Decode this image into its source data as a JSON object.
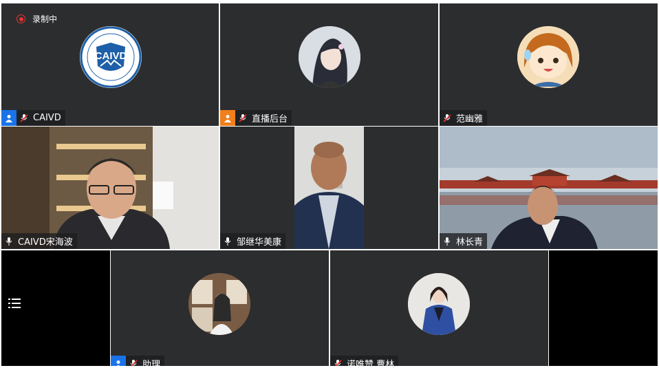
{
  "recording": {
    "label": "录制中"
  },
  "participants": [
    {
      "name": "CAIVD",
      "role": "host",
      "mic": "muted",
      "avatar": "caivd-logo",
      "logo_text": "CAIVD"
    },
    {
      "name": "直播后台",
      "role": "cohost",
      "mic": "muted",
      "avatar": "anime-girl-icon"
    },
    {
      "name": "范幽雅",
      "role": "",
      "mic": "muted",
      "avatar": "cartoon-girl-icon"
    },
    {
      "name": "CAIVD宋海波",
      "role": "",
      "mic": "on",
      "video": "man-in-office"
    },
    {
      "name": "邹继华美康",
      "role": "",
      "mic": "on",
      "video": "man-in-blue-jacket"
    },
    {
      "name": "林长青",
      "role": "",
      "mic": "on",
      "video": "man-with-forbidden-city-background"
    },
    {
      "name": "助理",
      "role": "host",
      "mic": "muted",
      "avatar": "woman-photo-icon"
    },
    {
      "name": "诺唯赞 曹林",
      "role": "",
      "mic": "muted",
      "avatar": "woman-in-blue-suit-icon"
    }
  ],
  "colors": {
    "tile_bg": "#2c2d2f",
    "host_badge": "#1a73e8",
    "cohost_badge": "#f07f1c",
    "record_red": "#e33333"
  },
  "sidebar": {
    "menu_icon": "list-menu-icon"
  }
}
